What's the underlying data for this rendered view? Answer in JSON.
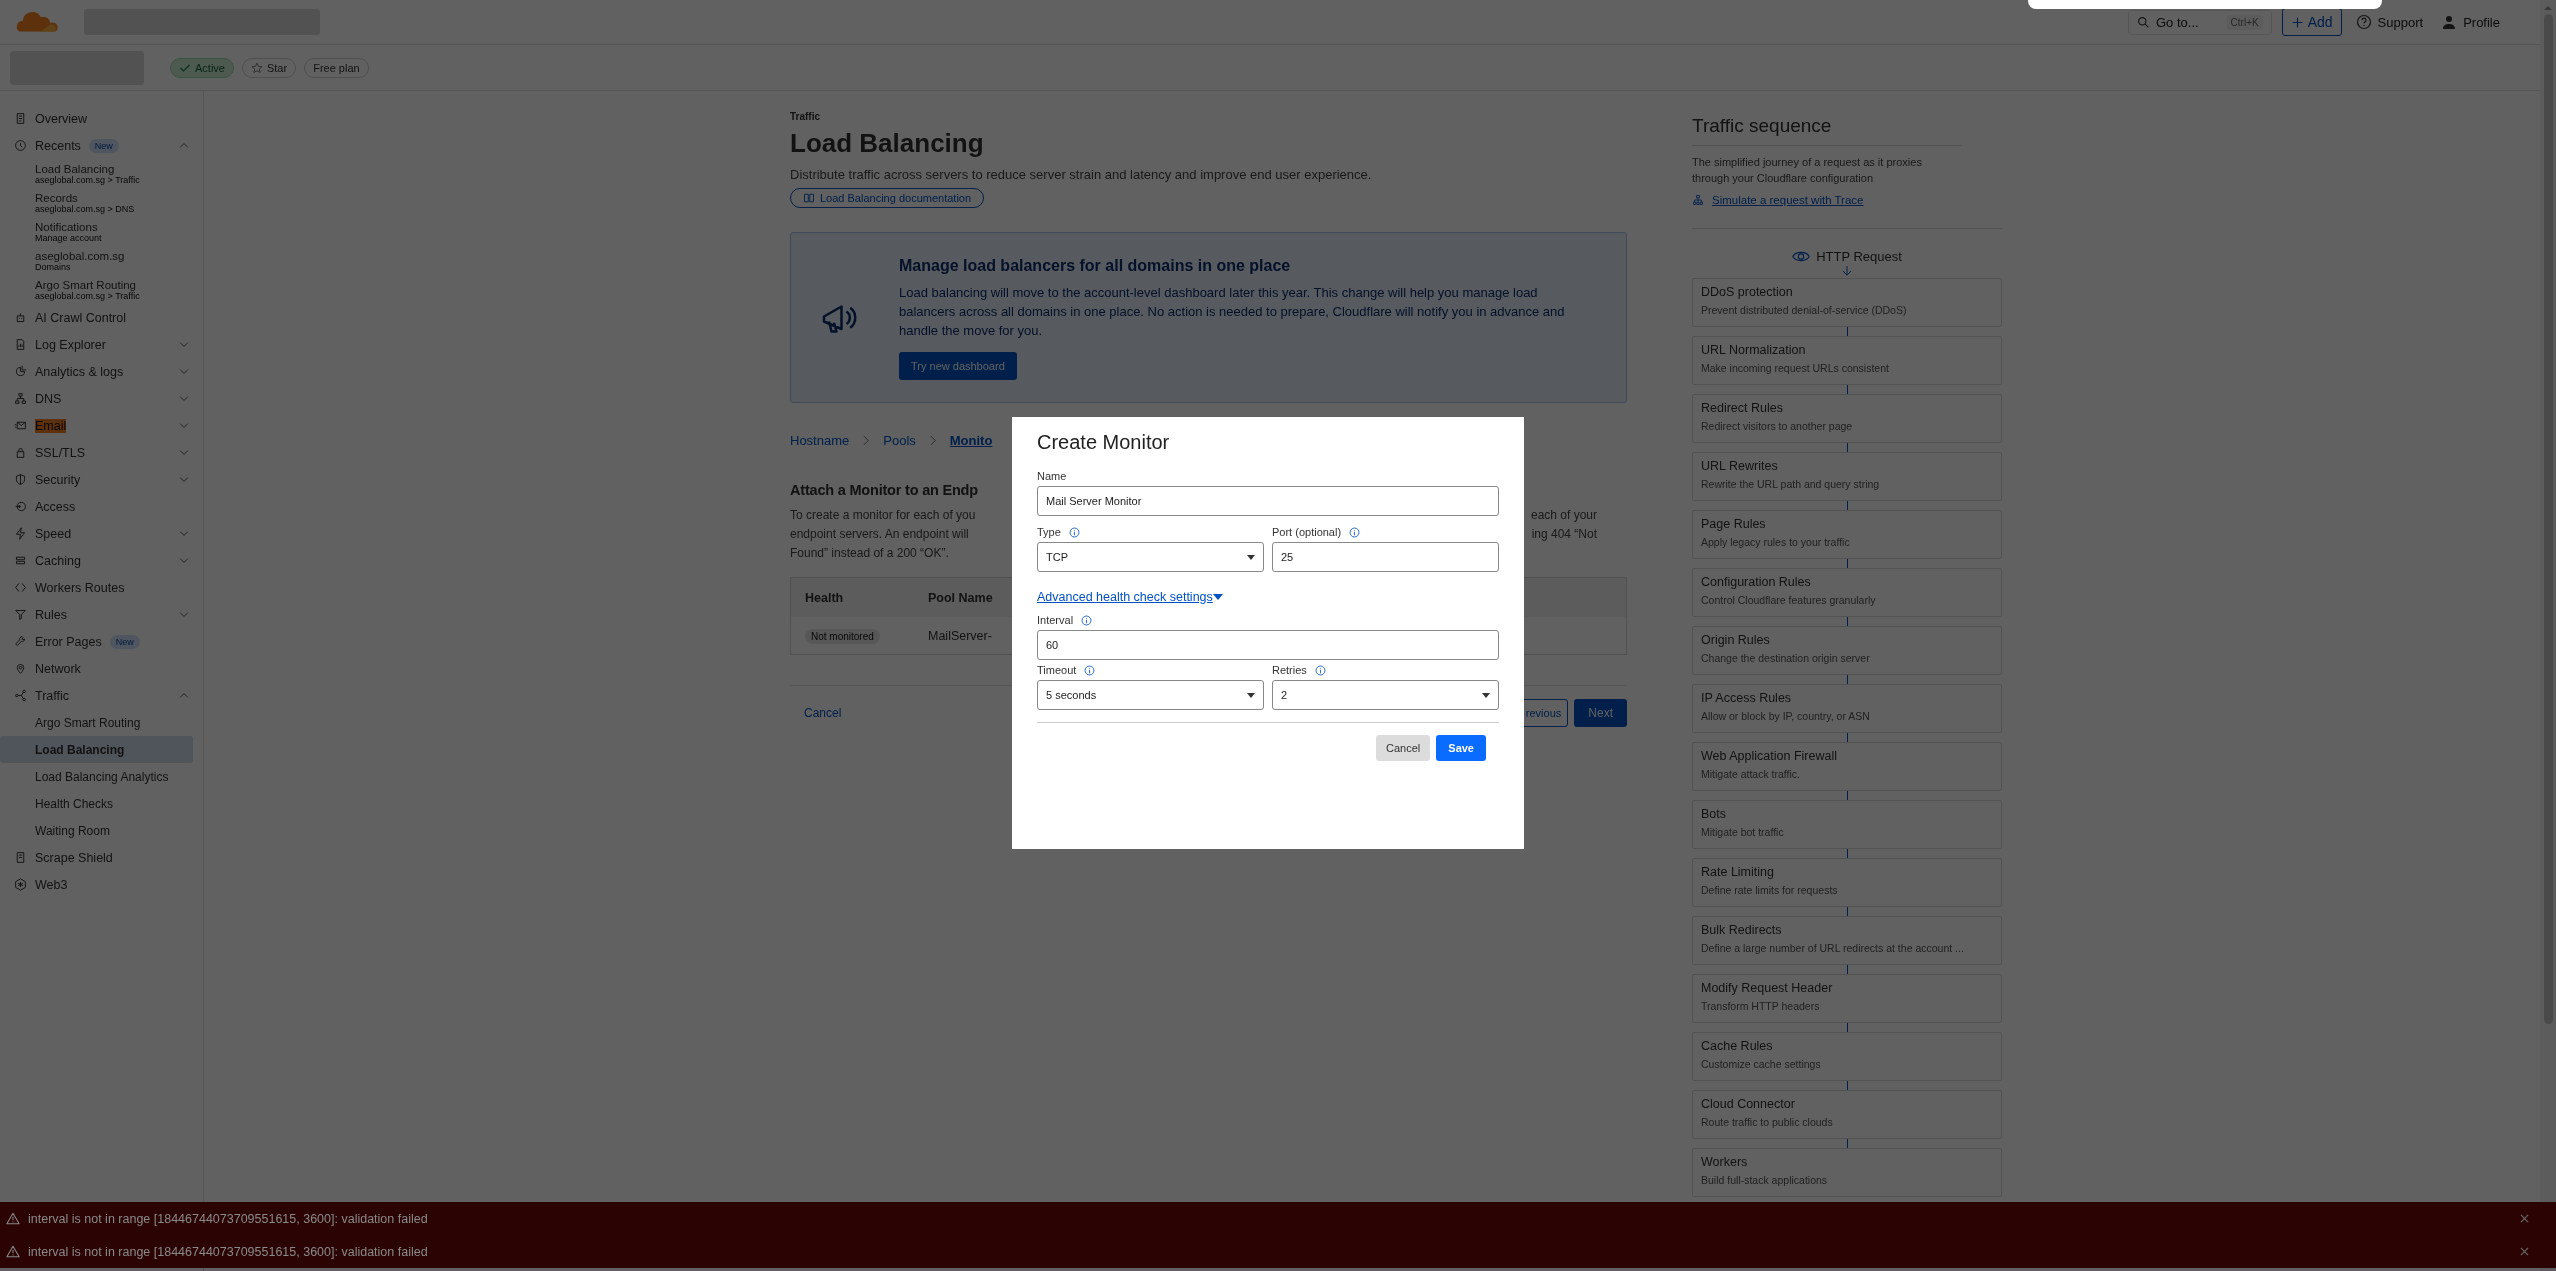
{
  "header": {
    "search": {
      "placeholder": "Go to...",
      "shortcut": "Ctrl+K"
    },
    "add_button": "Add",
    "support": "Support",
    "profile": "Profile"
  },
  "zone_bar": {
    "status": "Active",
    "star": "Star",
    "plan": "Free plan"
  },
  "sidebar": {
    "items": [
      {
        "label": "Overview",
        "kind": "link",
        "expanded": false,
        "selected": false,
        "highlighted": false
      },
      {
        "label": "Recents",
        "kind": "group",
        "expanded": true,
        "selected": false,
        "highlighted": false,
        "badge": "New",
        "children": [
          {
            "label": "Load Balancing",
            "sublabel": "aseglobal.com.sg > Traffic",
            "selected": false
          },
          {
            "label": "Records",
            "sublabel": "aseglobal.com.sg > DNS",
            "selected": false
          },
          {
            "label": "Notifications",
            "sublabel": "Manage account",
            "selected": false
          },
          {
            "label": "aseglobal.com.sg",
            "sublabel": "Domains",
            "selected": false
          },
          {
            "label": "Argo Smart Routing",
            "sublabel": "aseglobal.com.sg > Traffic",
            "selected": false
          }
        ]
      },
      {
        "label": "AI Crawl Control",
        "kind": "link",
        "expanded": false,
        "selected": false,
        "highlighted": false
      },
      {
        "label": "Log Explorer",
        "kind": "group",
        "expanded": false,
        "selected": false,
        "highlighted": false
      },
      {
        "label": "Analytics & logs",
        "kind": "group",
        "expanded": false,
        "selected": false,
        "highlighted": false
      },
      {
        "label": "DNS",
        "kind": "group",
        "expanded": false,
        "selected": false,
        "highlighted": false
      },
      {
        "label": "Email",
        "kind": "group",
        "expanded": false,
        "selected": false,
        "highlighted": true
      },
      {
        "label": "SSL/TLS",
        "kind": "group",
        "expanded": false,
        "selected": false,
        "highlighted": false
      },
      {
        "label": "Security",
        "kind": "group",
        "expanded": false,
        "selected": false,
        "highlighted": false
      },
      {
        "label": "Access",
        "kind": "link",
        "expanded": false,
        "selected": false,
        "highlighted": false
      },
      {
        "label": "Speed",
        "kind": "group",
        "expanded": false,
        "selected": false,
        "highlighted": false
      },
      {
        "label": "Caching",
        "kind": "group",
        "expanded": false,
        "selected": false,
        "highlighted": false
      },
      {
        "label": "Workers Routes",
        "kind": "link",
        "expanded": false,
        "selected": false,
        "highlighted": false
      },
      {
        "label": "Rules",
        "kind": "group",
        "expanded": false,
        "selected": false,
        "highlighted": false
      },
      {
        "label": "Error Pages",
        "kind": "link",
        "expanded": false,
        "selected": false,
        "highlighted": false,
        "badge": "New"
      },
      {
        "label": "Network",
        "kind": "link",
        "expanded": false,
        "selected": false,
        "highlighted": false
      },
      {
        "label": "Traffic",
        "kind": "group",
        "expanded": true,
        "selected": false,
        "highlighted": false,
        "children": [
          {
            "label": "Argo Smart Routing",
            "selected": false
          },
          {
            "label": "Load Balancing",
            "selected": true
          },
          {
            "label": "Load Balancing Analytics",
            "selected": false
          },
          {
            "label": "Health Checks",
            "selected": false
          },
          {
            "label": "Waiting Room",
            "selected": false
          }
        ]
      },
      {
        "label": "Scrape Shield",
        "kind": "link",
        "expanded": false,
        "selected": false,
        "highlighted": false
      },
      {
        "label": "Web3",
        "kind": "link",
        "expanded": false,
        "selected": false,
        "highlighted": false
      }
    ]
  },
  "page": {
    "eyebrow": "Traffic",
    "title": "Load Balancing",
    "description": "Distribute traffic across servers to reduce server strain and latency and improve end user experience.",
    "doc_link": "Load Balancing documentation",
    "banner": {
      "title": "Manage load balancers for all domains in one place",
      "text": "Load balancing will move to the account-level dashboard later this year. This change will help you manage load balancers across all domains in one place. No action is needed to prepare, Cloudflare will notify you in advance and handle the move for you.",
      "button": "Try new dashboard"
    },
    "breadcrumb": [
      {
        "label": "Hostname",
        "selected": false
      },
      {
        "label": "Pools",
        "selected": false
      },
      {
        "label": "Monito",
        "selected": true
      }
    ],
    "section": {
      "title": "Attach a Monitor to an Endp",
      "text_left": [
        "To create a monitor for each of you",
        "endpoint servers. An endpoint will",
        "Found” instead of a 200 “OK”."
      ],
      "text_right": [
        "each of your",
        "ing 404 “Not"
      ]
    },
    "table": {
      "columns": [
        "Health",
        "Pool Name"
      ],
      "rows": [
        {
          "health": "Not monitored",
          "pool_name": "MailServer-"
        }
      ]
    },
    "footer": {
      "cancel": "Cancel",
      "previous": "revious",
      "next": "Next"
    }
  },
  "traffic_sequence": {
    "title": "Traffic sequence",
    "description": "The simplified journey of a request as it proxies through your Cloudflare configuration",
    "trace_link": "Simulate a request with Trace",
    "start": "HTTP Request",
    "steps": [
      {
        "title": "DDoS protection",
        "description": "Prevent distributed denial-of-service (DDoS)"
      },
      {
        "title": "URL Normalization",
        "description": "Make incoming request URLs consistent"
      },
      {
        "title": "Redirect Rules",
        "description": "Redirect visitors to another page"
      },
      {
        "title": "URL Rewrites",
        "description": "Rewrite the URL path and query string"
      },
      {
        "title": "Page Rules",
        "description": "Apply legacy rules to your traffic"
      },
      {
        "title": "Configuration Rules",
        "description": "Control Cloudflare features granularly"
      },
      {
        "title": "Origin Rules",
        "description": "Change the destination origin server"
      },
      {
        "title": "IP Access Rules",
        "description": "Allow or block by IP, country, or ASN"
      },
      {
        "title": "Web Application Firewall",
        "description": "Mitigate attack traffic."
      },
      {
        "title": "Bots",
        "description": "Mitigate bot traffic"
      },
      {
        "title": "Rate Limiting",
        "description": "Define rate limits for requests"
      },
      {
        "title": "Bulk Redirects",
        "description": "Define a large number of URL redirects at the account ..."
      },
      {
        "title": "Modify Request Header",
        "description": "Transform HTTP headers"
      },
      {
        "title": "Cache Rules",
        "description": "Customize cache settings"
      },
      {
        "title": "Cloud Connector",
        "description": "Route traffic to public clouds"
      },
      {
        "title": "Workers",
        "description": "Build full-stack applications"
      }
    ]
  },
  "modal": {
    "title": "Create Monitor",
    "name_field": {
      "label": "Name",
      "kind": "text",
      "value": "Mail Server Monitor",
      "info": false
    },
    "type_field": {
      "label": "Type",
      "kind": "select",
      "value": "TCP",
      "info": true
    },
    "port_field": {
      "label": "Port (optional)",
      "kind": "text",
      "value": "25",
      "info": true
    },
    "advanced_link": {
      "label": "Advanced health check settings",
      "expanded": true
    },
    "interval_field": {
      "label": "Interval",
      "kind": "text",
      "value": "60",
      "info": true
    },
    "timeout_field": {
      "label": "Timeout",
      "kind": "select",
      "value": "5 seconds",
      "info": true
    },
    "retries_field": {
      "label": "Retries",
      "kind": "select",
      "value": "2",
      "info": true
    },
    "cancel": "Cancel",
    "save": "Save"
  },
  "toasts": [
    {
      "message": "interval is not in range [18446744073709551615, 3600]: validation failed"
    },
    {
      "message": "interval is not in range [18446744073709551615, 3600]: validation failed"
    }
  ]
}
